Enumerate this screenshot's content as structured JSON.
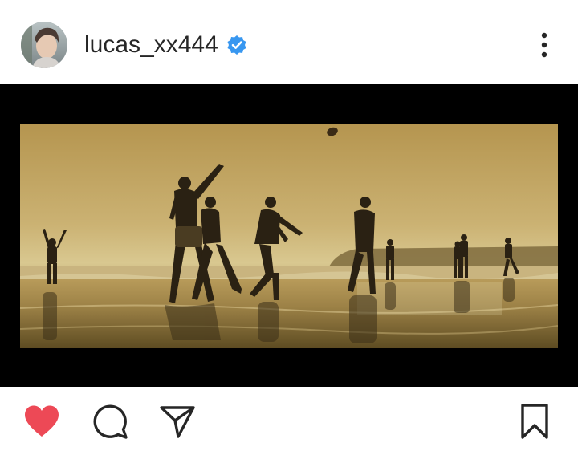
{
  "post": {
    "username": "lucas_xx444",
    "verified": true,
    "avatar_icon": "profile-photo",
    "more_icon": "more-vertical-icon"
  },
  "media": {
    "scene": "beach-silhouettes-sunset-photo"
  },
  "actions": {
    "like_icon": "heart-icon",
    "like_active": true,
    "comment_icon": "comment-icon",
    "share_icon": "share-icon",
    "save_icon": "bookmark-icon"
  },
  "colors": {
    "like": "#ed4956",
    "verified": "#3897f0",
    "text": "#262626",
    "sky_top": "#b99a55",
    "sky_bottom": "#d9c88f"
  }
}
